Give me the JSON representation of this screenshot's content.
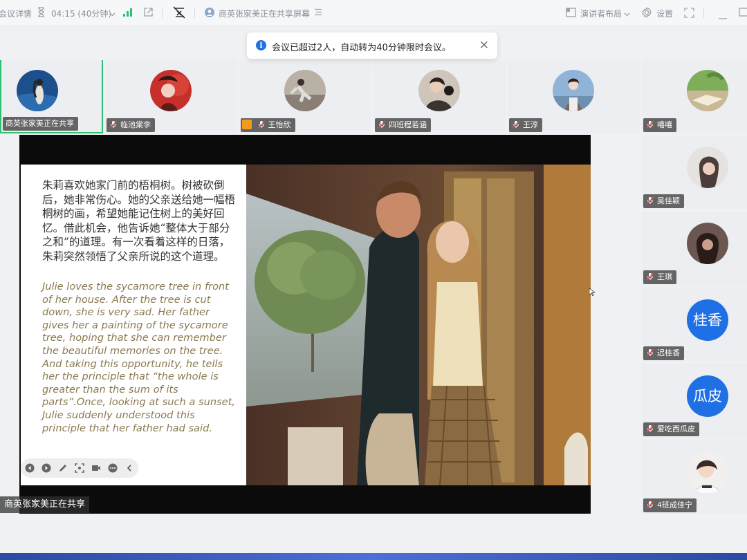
{
  "topbar": {
    "meeting_details": "会议详情",
    "timer": "04:15 (40分钟)",
    "sharing_status": "商英张家美正在共享屏幕",
    "layout_label": "演讲者布局",
    "settings_label": "设置"
  },
  "toast": {
    "message": "会议已超过2人，自动转为40分钟限时会议。",
    "close": "×"
  },
  "participants_top": [
    {
      "name": "商英张家美正在共享"
    },
    {
      "name": "临池棠李"
    },
    {
      "name": "王怡欣"
    },
    {
      "name": "四班程若涵"
    },
    {
      "name": "王淳"
    },
    {
      "name": "嘻嘻"
    }
  ],
  "participants_side": [
    {
      "name": "吴佳颖"
    },
    {
      "name": "王琪"
    },
    {
      "name": "迟桂香",
      "initials": "桂香"
    },
    {
      "name": "爱吃西瓜皮",
      "initials": "瓜皮"
    },
    {
      "name": "4班成佳宁"
    }
  ],
  "slide": {
    "chinese_text": "朱莉喜欢她家门前的梧桐树。树被砍倒后，她非常伤心。她的父亲送给她一幅梧桐树的画，希望她能记住树上的美好回忆。借此机会，他告诉她“整体大于部分之和”的道理。有一次看着这样的日落，朱莉突然领悟了父亲所说的这个道理。",
    "english_text": "Julie loves the sycamore tree in front of her house. After the tree is cut down, she is very sad. Her father gives her a painting of the sycamore tree, hoping that she can remember the beautiful memories on the tree. And taking this opportunity, he tells her the principle that “the whole is greater than the sum of its parts”.Once, looking at such a sunset, Julie suddenly understood this principle that her father had said."
  },
  "share_label": "商英张家美正在共享",
  "colors": {
    "accent": "#1f6fe5",
    "active_speaker": "#2fbf71",
    "en_text": "#8a7a52"
  }
}
